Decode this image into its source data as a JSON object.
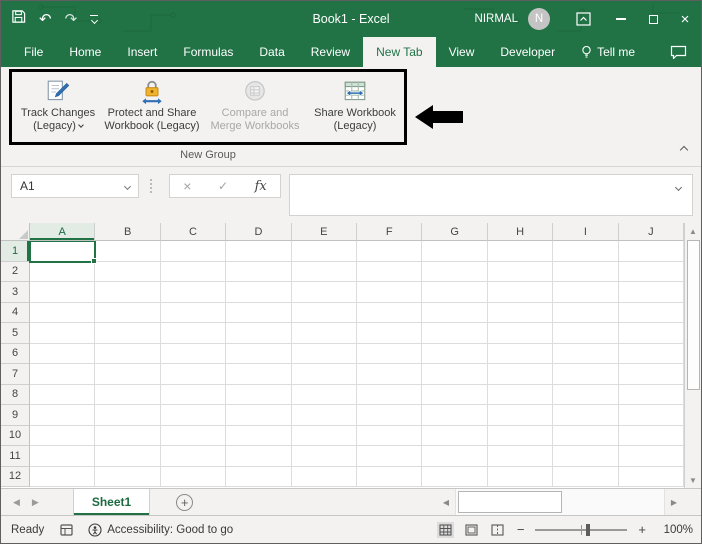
{
  "colors": {
    "accent_green": "#217346",
    "ribbon_bg": "#f3f2f1",
    "highlight_box": "#000000",
    "disabled_text": "#a8a8a8"
  },
  "titlebar": {
    "title": "Book1 - Excel",
    "user_name": "NIRMAL",
    "avatar_initial": "N"
  },
  "quick_access": {
    "undo": "↶",
    "redo": "↷"
  },
  "tabs": [
    {
      "label": "File"
    },
    {
      "label": "Home"
    },
    {
      "label": "Insert"
    },
    {
      "label": "Formulas"
    },
    {
      "label": "Data"
    },
    {
      "label": "Review"
    },
    {
      "label": "New Tab"
    },
    {
      "label": "View"
    },
    {
      "label": "Developer"
    },
    {
      "label": "Tell me"
    }
  ],
  "ribbon": {
    "group_label": "New Group",
    "buttons": [
      {
        "line1": "Track Changes",
        "line2": "(Legacy)",
        "dropdown": true,
        "disabled": false
      },
      {
        "line1": "Protect and Share",
        "line2": "Workbook (Legacy)",
        "dropdown": false,
        "disabled": false
      },
      {
        "line1": "Compare and",
        "line2": "Merge Workbooks",
        "dropdown": false,
        "disabled": true
      },
      {
        "line1": "Share Workbook",
        "line2": "(Legacy)",
        "dropdown": false,
        "disabled": false
      }
    ]
  },
  "formula_bar": {
    "name_box_value": "A1",
    "cancel_glyph": "×",
    "enter_glyph": "✓",
    "fx_label": "fx",
    "formula_value": ""
  },
  "grid": {
    "columns": [
      "A",
      "B",
      "C",
      "D",
      "E",
      "F",
      "G",
      "H",
      "I",
      "J"
    ],
    "rows": [
      "1",
      "2",
      "3",
      "4",
      "5",
      "6",
      "7",
      "8",
      "9",
      "10",
      "11",
      "12"
    ],
    "active_cell": "A1"
  },
  "scrollbar": {
    "up": "▲",
    "down": "▼",
    "left": "◀",
    "right": "▶"
  },
  "sheet_bar": {
    "prev_glyph": "◀",
    "next_glyph": "▶",
    "sheet_name": "Sheet1",
    "add_sheet_label": "+"
  },
  "status_bar": {
    "mode": "Ready",
    "accessibility_label": "Accessibility: Good to go",
    "zoom_out": "−",
    "zoom_in": "+",
    "zoom_level": "100%"
  },
  "window_controls": {
    "close": "×"
  }
}
